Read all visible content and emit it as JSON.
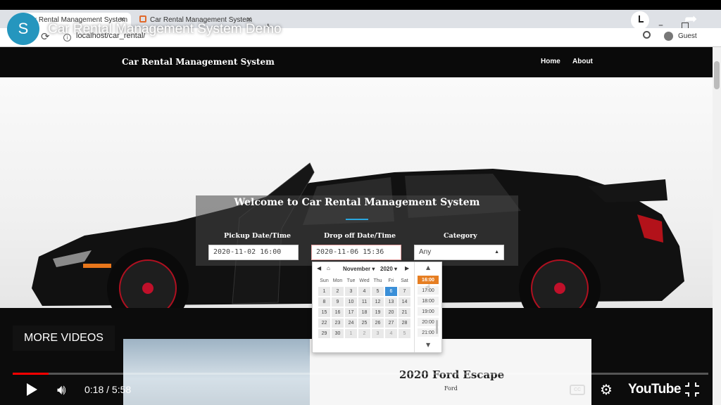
{
  "browser": {
    "tabs": [
      {
        "label": "Car Rental Management System",
        "active": true
      },
      {
        "label": "Car Rental Management System",
        "active": false
      }
    ],
    "new_tab_icon": "+",
    "url": "localhost/car_rental/",
    "profile_label": "Guest"
  },
  "site": {
    "brand": "Car Rental Management System",
    "nav": [
      "Home",
      "About"
    ]
  },
  "hero": {
    "welcome": "Welcome to Car Rental Management System",
    "pickup_label": "Pickup Date/Time",
    "pickup_value": "2020-11-02 16:00",
    "dropoff_label": "Drop off Date/Time",
    "dropoff_value": "2020-11-06 15:36",
    "category_label": "Category",
    "category_value": "Any"
  },
  "datepicker": {
    "month": "November",
    "year": "2020",
    "weekdays": [
      "Sun",
      "Mon",
      "Tue",
      "Wed",
      "Thu",
      "Fri",
      "Sat"
    ],
    "weeks": [
      [
        "1",
        "2",
        "3",
        "4",
        "5",
        "6",
        "7"
      ],
      [
        "8",
        "9",
        "10",
        "11",
        "12",
        "13",
        "14"
      ],
      [
        "15",
        "16",
        "17",
        "18",
        "19",
        "20",
        "21"
      ],
      [
        "22",
        "23",
        "24",
        "25",
        "26",
        "27",
        "28"
      ],
      [
        "29",
        "30",
        "1",
        "2",
        "3",
        "4",
        "5"
      ]
    ],
    "selected_day": "6",
    "times": [
      "16:00",
      "17:00",
      "18:00",
      "19:00",
      "20:00",
      "21:00"
    ],
    "selected_time": "16:00"
  },
  "listing": {
    "title": "2020 Ford Escape",
    "subtitle": "Ford"
  },
  "youtube": {
    "channel_initial": "S",
    "title": "Car Rental Management System Demo",
    "watch_later": "Watch later",
    "share": "Share",
    "more_videos": "MORE VIDEOS",
    "time": "0:18 / 5:58",
    "progress_fraction": 0.052,
    "cc_label": "CC",
    "logo": "YouTube",
    "accent_color": "#ff0000",
    "avatar_color": "#2596be"
  },
  "icons": [
    "back-icon",
    "reload-icon",
    "info-icon",
    "search-icon",
    "profile-icon",
    "watch-later-icon",
    "share-icon",
    "play-icon",
    "volume-icon",
    "settings-icon",
    "exit-fullscreen-icon",
    "cursor-icon"
  ]
}
